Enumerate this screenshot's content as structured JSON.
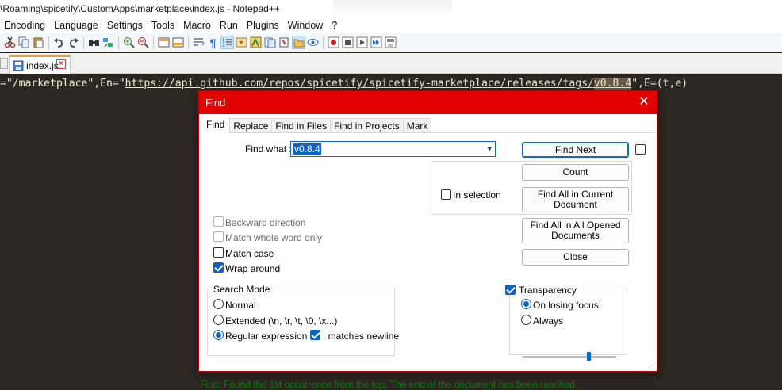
{
  "window": {
    "title": "\\Roaming\\spicetify\\CustomApps\\marketplace\\index.js - Notepad++"
  },
  "menu": [
    "Encoding",
    "Language",
    "Settings",
    "Tools",
    "Macro",
    "Run",
    "Plugins",
    "Window",
    "?"
  ],
  "toolbar": {
    "icons": [
      "cut-icon",
      "copy-icon",
      "paste-icon",
      "undo-icon",
      "redo-icon",
      "find-icon",
      "replace-icon",
      "zoom-in-icon",
      "zoom-out-icon",
      "sync-vertical-icon",
      "sync-horizontal-icon",
      "word-wrap-icon",
      "show-all-chars-icon",
      "indent-guide-icon",
      "doc-map-icon",
      "doc-list-icon",
      "function-list-icon",
      "folder-workspace-icon",
      "monitoring-icon",
      "record-macro-icon",
      "stop-record-icon",
      "play-macro-icon",
      "run-macro-multiple-icon",
      "save-macro-icon"
    ]
  },
  "tab": {
    "label": "index.js"
  },
  "editor": {
    "prefix": "=\"/marketplace\",En=\"",
    "url_main": "https://api.github.com/repos/spicetify/spicetify-marketplace/releases/tags/",
    "url_hl": "v0.8.4",
    "suffix": "\",E=(t,e)"
  },
  "find_dialog": {
    "title": "Find",
    "tabs": [
      "Find",
      "Replace",
      "Find in Files",
      "Find in Projects",
      "Mark"
    ],
    "find_what_label": "Find what :",
    "find_what_value": "v0.8.4",
    "buttons": {
      "find_next": "Find Next",
      "count": "Count",
      "find_all_current_line1": "Find All in Current",
      "find_all_current_line2": "Document",
      "find_all_opened_line1": "Find All in All Opened",
      "find_all_opened_line2": "Documents",
      "close": "Close"
    },
    "options": {
      "in_selection": "In selection",
      "backward": "Backward direction",
      "whole_word": "Match whole word only",
      "match_case": "Match case",
      "wrap_around": "Wrap around",
      "wrap_around_checked": true,
      "match_case_checked": false
    },
    "search_mode": {
      "label": "Search Mode",
      "normal": "Normal",
      "extended": "Extended (\\n, \\r, \\t, \\0, \\x...)",
      "regex": "Regular expression",
      "matches_newline": ". matches newline",
      "selected": "regex"
    },
    "transparency": {
      "label": "Transparency",
      "on_losing_focus": "On losing focus",
      "always": "Always",
      "level": 0.7
    },
    "status": "Find: Found the 1st occurrence from the top. The end of the document has been reached."
  },
  "colors": {
    "dialog_title_bg": "#e30000",
    "accent": "#0a64c8",
    "status_text": "#0a7a0a",
    "editor_bg": "#2d2722"
  }
}
